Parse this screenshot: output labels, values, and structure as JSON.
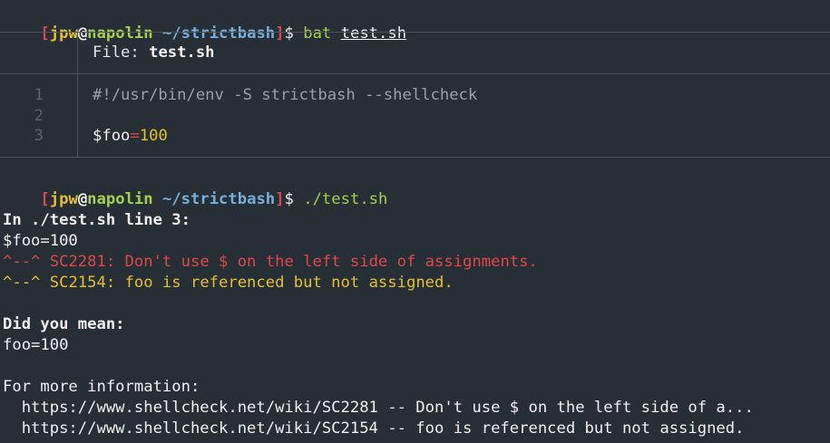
{
  "prompt": {
    "open_bracket": "[",
    "user": "jpw",
    "at": "@",
    "host": "napolin",
    "cwd": "~/strictbash",
    "close_bracket": "]",
    "dollar": "$"
  },
  "commands": {
    "first_cmd": "bat",
    "first_arg": "test.sh",
    "second_cmd": "./test.sh"
  },
  "bat": {
    "file_label": "File: ",
    "file_name": "test.sh",
    "line_numbers": [
      "1",
      "2",
      "3"
    ],
    "line1": "#!/usr/bin/env -S strictbash --shellcheck",
    "line3_var": "$foo",
    "line3_eq": "=",
    "line3_val": "100"
  },
  "output": {
    "location": "In ./test.sh line 3:",
    "source": "$foo=100",
    "error_marker": "^--^",
    "error_text": " SC2281: Don't use $ on the left side of assignments.",
    "warn_marker": "^--^",
    "warn_text": " SC2154: foo is referenced but not assigned.",
    "did_you_mean": "Did you mean:",
    "suggestion": "foo=100",
    "more_info": "For more information:",
    "link1": "  https://www.shellcheck.net/wiki/SC2281 -- Don't use $ on the left side of a...",
    "link2": "  https://www.shellcheck.net/wiki/SC2154 -- foo is referenced but not assigned."
  },
  "colors": {
    "background": "#262e36",
    "error": "#e04848",
    "warning": "#e6c02c",
    "host": "#a4d24c",
    "cwd": "#79aed8",
    "bracket": "#e04848"
  }
}
